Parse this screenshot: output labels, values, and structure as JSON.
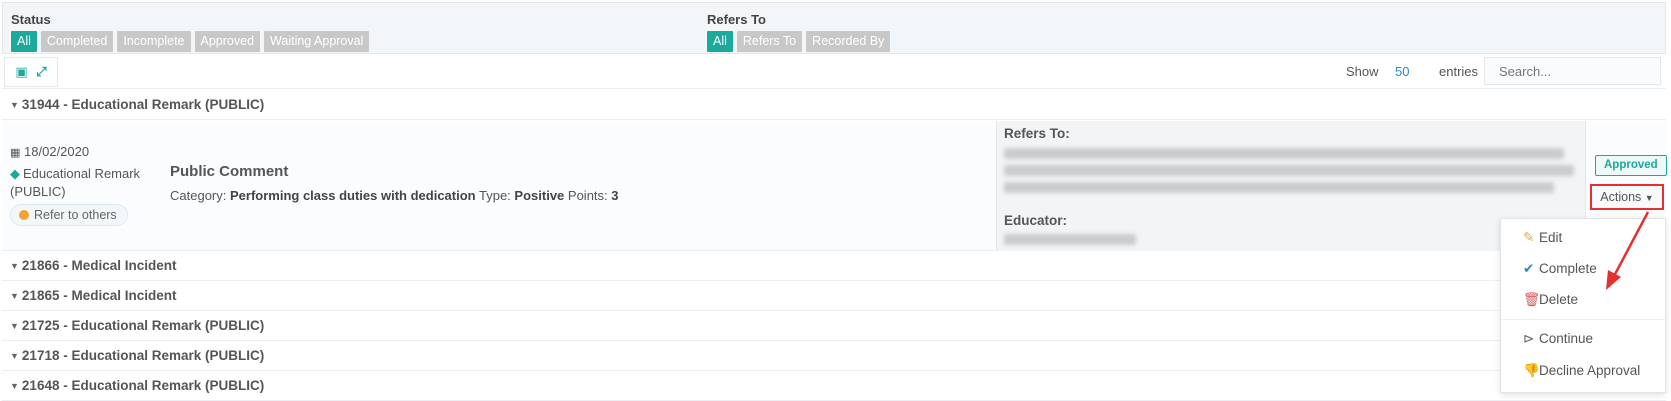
{
  "filters": {
    "status": {
      "title": "Status",
      "chips": [
        "All",
        "Completed",
        "Incomplete",
        "Approved",
        "Waiting Approval"
      ]
    },
    "refers_to": {
      "title": "Refers To",
      "chips": [
        "All",
        "Refers To",
        "Recorded By"
      ]
    }
  },
  "toolbar": {
    "show_label": "Show",
    "show_value": "50",
    "entries_label": "entries",
    "search_placeholder": "Search..."
  },
  "groups": [
    "31944 - Educational Remark (PUBLIC)",
    "21866 - Medical Incident",
    "21865 - Medical Incident",
    "21725 - Educational Remark (PUBLIC)",
    "21718 - Educational Remark (PUBLIC)",
    "21648 - Educational Remark (PUBLIC)"
  ],
  "record": {
    "date": "18/02/2020",
    "type": "Educational Remark (PUBLIC)",
    "refer_pill": "Refer to others",
    "title": "Public Comment",
    "category_label": "Category:",
    "category_value": "Performing class duties with dedication",
    "type_label": "Type:",
    "type_value": "Positive",
    "points_label": "Points:",
    "points_value": "3",
    "refers_title": "Refers To:",
    "educator_title": "Educator:",
    "status_badge": "Approved",
    "actions_label": "Actions"
  },
  "dropdown": {
    "items": [
      "Edit",
      "Complete",
      "Delete",
      "Continue",
      "Decline Approval"
    ]
  },
  "colors": {
    "accent": "#1aa99a",
    "chip_inactive": "#c8c8c8",
    "highlight": "#e53030",
    "pill_dot": "#f0a431"
  }
}
